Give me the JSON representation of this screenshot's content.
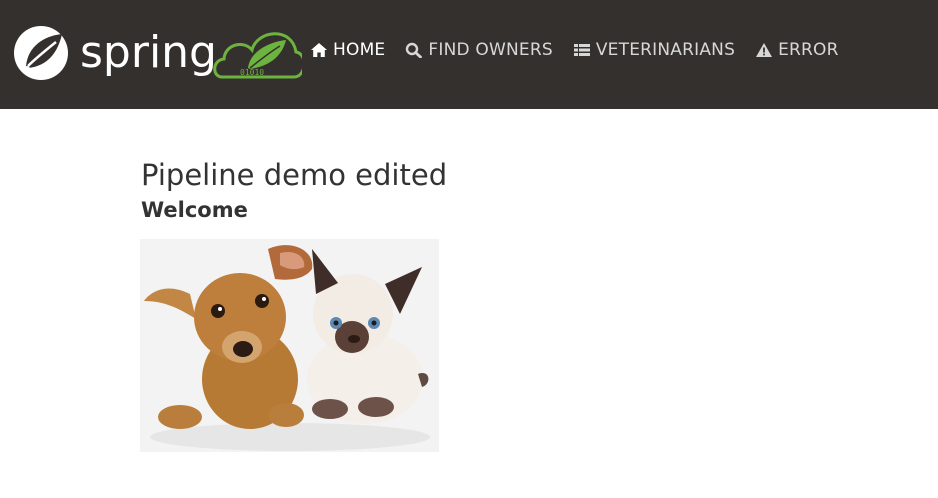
{
  "brand": {
    "logo_text": "spring",
    "badge_digits": "01010"
  },
  "nav": [
    {
      "label": "HOME",
      "icon": "home-icon",
      "active": true
    },
    {
      "label": "FIND OWNERS",
      "icon": "search-icon",
      "active": false
    },
    {
      "label": "VETERINARIANS",
      "icon": "list-icon",
      "active": false
    },
    {
      "label": "ERROR",
      "icon": "warning-icon",
      "active": false
    }
  ],
  "main": {
    "title": "Pipeline demo edited",
    "subtitle": "Welcome"
  },
  "colors": {
    "navbar_bg": "#34302d",
    "spring_green": "#6db33f",
    "nav_text": "#d7d7d7",
    "nav_active": "#ffffff"
  }
}
